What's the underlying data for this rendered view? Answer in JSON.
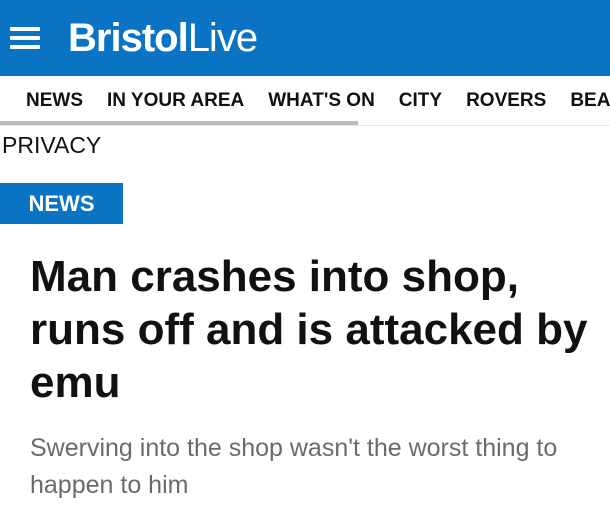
{
  "header": {
    "logo_bold": "Bristol",
    "logo_light": "Live"
  },
  "nav": {
    "items": [
      "NEWS",
      "IN YOUR AREA",
      "WHAT'S ON",
      "CITY",
      "ROVERS",
      "BEA"
    ]
  },
  "privacy_link": "PRIVACY",
  "article": {
    "category": "NEWS",
    "headline": "Man crashes into shop, runs off and is attacked by emu",
    "standfirst": "Swerving into the shop wasn't the worst thing to happen to him"
  },
  "colors": {
    "brand_blue": "#0a73c3",
    "subhead_gray": "#6b6b6b"
  }
}
